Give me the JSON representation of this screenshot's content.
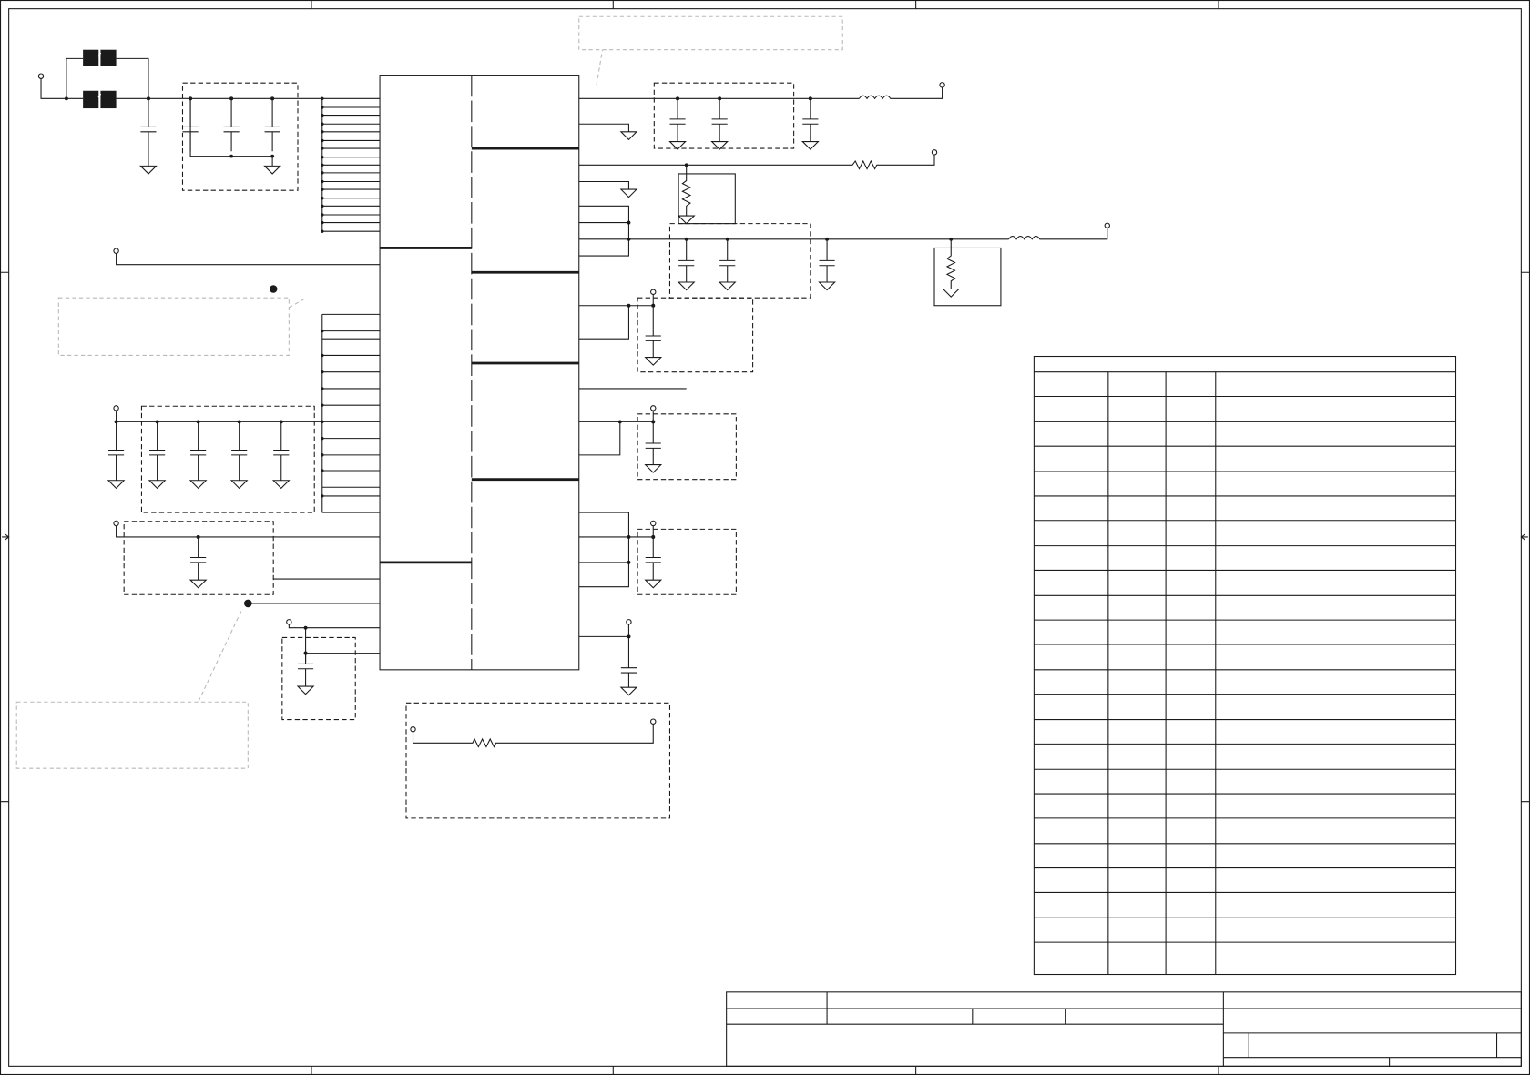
{
  "diagram": {
    "kind": "schematic-sheet",
    "colors": {
      "ink": "#1a1a1a",
      "annotation": "#b9b9b9",
      "background": "#ffffff"
    },
    "connector_table": {
      "columns": 4,
      "rows": 23,
      "labels_visible": false
    },
    "title_block": {
      "labels_visible": false
    }
  }
}
